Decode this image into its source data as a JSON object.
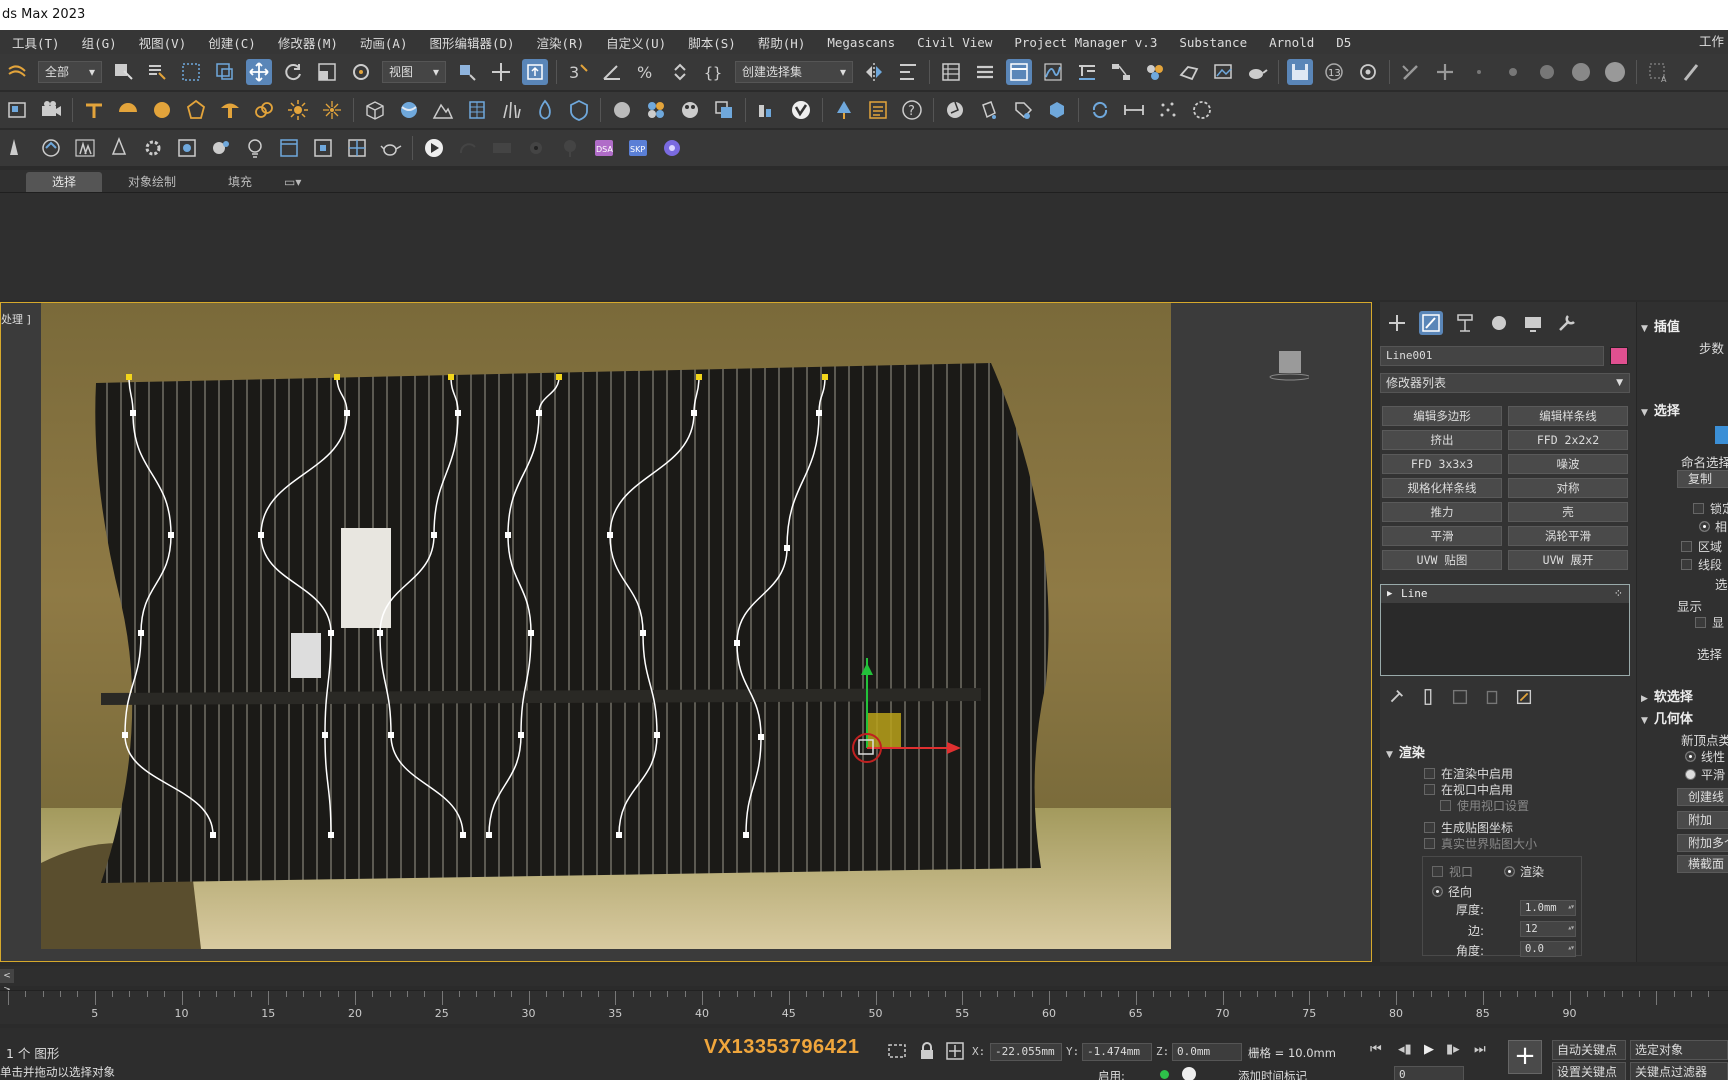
{
  "window": {
    "title": "ds Max 2023"
  },
  "menu": {
    "items": [
      "工具(T)",
      "组(G)",
      "视图(V)",
      "创建(C)",
      "修改器(M)",
      "动画(A)",
      "图形编辑器(D)",
      "渲染(R)",
      "自定义(U)",
      "脚本(S)",
      "帮助(H)",
      "Megascans",
      "Civil View",
      "Project Manager v.3",
      "Substance",
      "Arnold",
      "D5"
    ],
    "right_label": "工作"
  },
  "toolbar": {
    "filter_dropdown": "全部",
    "coord_dropdown": "视图",
    "selection_set_dropdown": "创建选择集",
    "snap_badge": "13"
  },
  "ribbon": {
    "tabs": [
      "选择",
      "对象绘制",
      "填充"
    ]
  },
  "viewport": {
    "label": "处理 ]",
    "colors": {
      "border": "#d6a92c",
      "spline": "#ffffff",
      "vertex_first": "#f2d51b"
    }
  },
  "command_panel": {
    "object_name": "Line001",
    "object_color": "#e05090",
    "modifier_list": "修改器列表",
    "modifier_buttons": [
      "编辑多边形",
      "编辑样条线",
      "挤出",
      "FFD 2x2x2",
      "FFD 3x3x3",
      "噪波",
      "规格化样条线",
      "对称",
      "推力",
      "壳",
      "平滑",
      "涡轮平滑",
      "UVW 贴图",
      "UVW 展开"
    ],
    "stack_item": "Line",
    "render_rollout": {
      "title": "渲染",
      "enable_in_renderer": "在渲染中启用",
      "enable_in_viewport": "在视口中启用",
      "use_viewport_settings": "使用视口设置",
      "generate_mapping": "生成贴图坐标",
      "real_world_map_size": "真实世界贴图大小",
      "viewport_option": "视口",
      "render_option": "渲染",
      "radial": "径向",
      "thickness_label": "厚度:",
      "thickness_value": "1.0mm",
      "sides_label": "边:",
      "sides_value": "12",
      "angle_label": "角度:",
      "angle_value": "0.0"
    },
    "right_rollouts": {
      "interpolation": "插值",
      "steps": "步数",
      "selection": "选择",
      "named_selection": "命名选择",
      "copy": "复制",
      "lock": "锁定",
      "phase": "相",
      "area": "区域",
      "segment": "线段",
      "select": "选",
      "display": "显示",
      "display_item": "显",
      "select2": "选择",
      "soft_selection": "软选择",
      "geometry": "几何体",
      "new_vertex_type": "新顶点类",
      "linear": "线性",
      "smooth": "平滑",
      "create_line": "创建线",
      "attach": "附加",
      "attach_multiple": "附加多个",
      "cross_section": "横截面"
    }
  },
  "timeline": {
    "ticks": [
      5,
      10,
      15,
      20,
      25,
      30,
      35,
      40,
      45,
      50,
      55,
      60,
      65,
      70,
      75,
      80,
      85,
      90
    ]
  },
  "status": {
    "selection_count": "1 个 图形",
    "prompt": "单击并拖动以选择对象",
    "watermark": "VX13353796421",
    "x_label": "X:",
    "x_value": "-22.055mm",
    "y_label": "Y:",
    "y_value": "-1.474mm",
    "z_label": "Z:",
    "z_value": "0.0mm",
    "grid": "栅格 = 10.0mm",
    "enable": "启用:",
    "add_time_tag": "添加时间标记",
    "auto_key": "自动关键点",
    "selected_object": "选定对象",
    "set_key": "设置关键点",
    "key_filters": "关键点过滤器",
    "frame": "0"
  }
}
